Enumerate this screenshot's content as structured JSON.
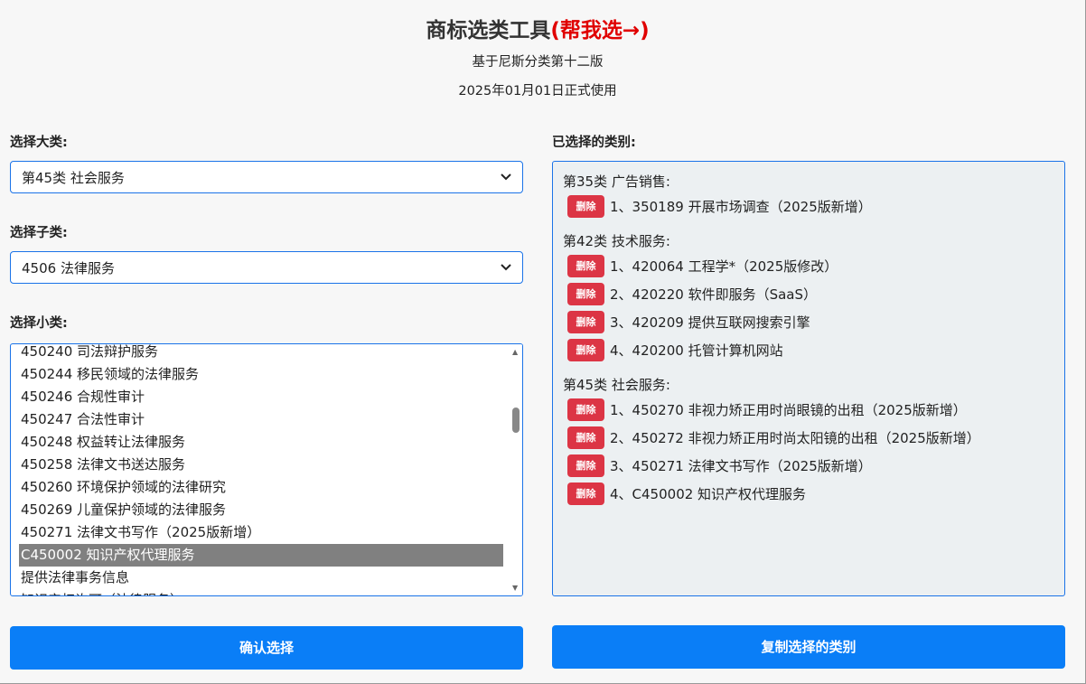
{
  "header": {
    "title": "商标选类工具",
    "title_highlight": "(帮我选→)",
    "subtitle1": "基于尼斯分类第十二版",
    "subtitle2": "2025年01月01日正式使用"
  },
  "left": {
    "category_label": "选择大类:",
    "category_value": "第45类 社会服务",
    "subcategory_label": "选择子类:",
    "subcategory_value": "4506 法律服务",
    "items_label": "选择小类:",
    "items": [
      "450240 司法辩护服务",
      "450244 移民领域的法律服务",
      "450246 合规性审计",
      "450247 合法性审计",
      "450248 权益转让法律服务",
      "450258 法律文书送达服务",
      "450260 环境保护领域的法律研究",
      "450269 儿童保护领域的法律服务",
      "450271 法律文书写作（2025版新增）",
      "C450002 知识产权代理服务",
      "提供法律事务信息",
      "知识产权许可（法律服务）"
    ],
    "selected_item": "C450002 知识产权代理服务",
    "confirm_button": "确认选择"
  },
  "right": {
    "label": "已选择的类别:",
    "delete_label": "删除",
    "groups": [
      {
        "title": "第35类 广告销售:",
        "items": [
          "1、350189 开展市场调查（2025版新增）"
        ]
      },
      {
        "title": "第42类 技术服务:",
        "items": [
          "1、420064 工程学*（2025版修改）",
          "2、420220 软件即服务（SaaS）",
          "3、420209 提供互联网搜索引擎",
          "4、420200 托管计算机网站"
        ]
      },
      {
        "title": "第45类 社会服务:",
        "items": [
          "1、450270 非视力矫正用时尚眼镜的出租（2025版新增）",
          "2、450272 非视力矫正用时尚太阳镜的出租（2025版新增）",
          "3、450271 法律文书写作（2025版新增）",
          "4、C450002 知识产权代理服务"
        ]
      }
    ],
    "copy_button": "复制选择的类别"
  },
  "icons": {
    "dropdown": "chevron-down-icon",
    "scroll_up": "arrow-up-icon",
    "scroll_down": "arrow-down-icon"
  },
  "colors": {
    "accent": "#0a7ef7",
    "danger": "#dc3545",
    "highlight": "#e00000",
    "selected_row": "#808080"
  }
}
